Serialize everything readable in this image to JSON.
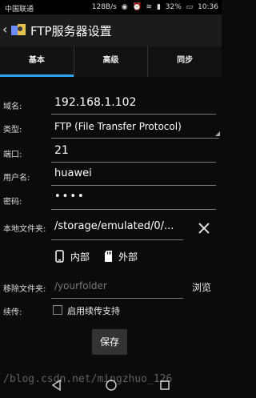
{
  "status_bar": {
    "carrier": "中国联通",
    "network_speed": "128B/s",
    "battery": "32%",
    "time": "10:36"
  },
  "title_bar": {
    "title": "FTP服务器设置"
  },
  "tabs": [
    {
      "label": "基本",
      "active": true
    },
    {
      "label": "高级",
      "active": false
    },
    {
      "label": "同步",
      "active": false
    }
  ],
  "form": {
    "domain_label": "域名:",
    "domain_value": "192.168.1.102",
    "type_label": "类型:",
    "type_value": "FTP (File Transfer Protocol)",
    "port_label": "端口:",
    "port_value": "21",
    "username_label": "用户名:",
    "username_value": "huawei",
    "password_label": "密码:",
    "password_value": "••••",
    "local_folder_label": "本地文件夹:",
    "local_folder_value": "/storage/emulated/0/...",
    "storage_internal": "内部",
    "storage_external": "外部",
    "remote_folder_label": "移除文件夹:",
    "remote_folder_placeholder": "/yourfolder",
    "browse_label": "浏览",
    "resume_label": "续传:",
    "resume_checkbox_label": "启用续传支持",
    "save_label": "保存"
  },
  "watermark": "/blog.csdn.net/mingzhuo_126",
  "colors": {
    "accent": "#2ea3f2",
    "background": "#0b0b0b"
  }
}
